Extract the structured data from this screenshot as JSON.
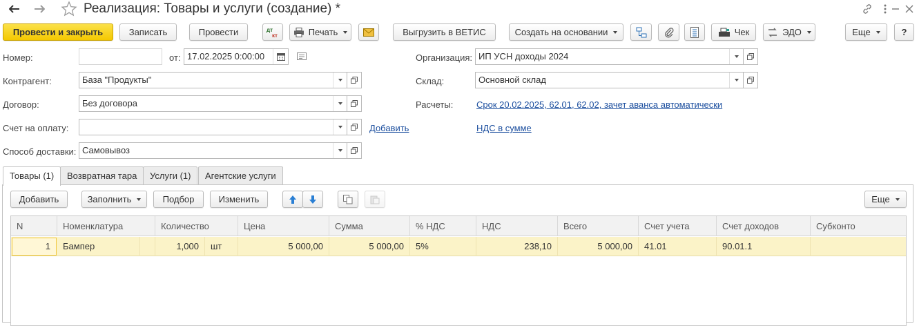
{
  "window": {
    "title": "Реализация: Товары и услуги (создание) *"
  },
  "toolbar": {
    "post_and_close": "Провести и закрыть",
    "save": "Записать",
    "post": "Провести",
    "print": "Печать",
    "export_vetis": "Выгрузить в ВЕТИС",
    "create_based_on": "Создать на основании",
    "receipt": "Чек",
    "edo": "ЭДО",
    "more": "Еще",
    "help": "?"
  },
  "form": {
    "number": {
      "label": "Номер:",
      "value": ""
    },
    "date": {
      "label": "от:",
      "value": "17.02.2025  0:00:00"
    },
    "organization": {
      "label": "Организация:",
      "value": "ИП УСН доходы 2024"
    },
    "counterparty": {
      "label": "Контрагент:",
      "value": "База \"Продукты\""
    },
    "warehouse": {
      "label": "Склад:",
      "value": "Основной склад"
    },
    "contract": {
      "label": "Договор:",
      "value": "Без договора"
    },
    "settlements": {
      "label": "Расчеты:",
      "link": "Срок 20.02.2025, 62.01, 62.02, зачет аванса автоматически"
    },
    "invoice": {
      "label": "Счет на оплату:",
      "value": "",
      "add_link": "Добавить"
    },
    "vat_link": "НДС в сумме",
    "delivery": {
      "label": "Способ доставки:",
      "value": "Самовывоз"
    }
  },
  "tabs": [
    {
      "label": "Товары (1)",
      "active": true
    },
    {
      "label": "Возвратная тара",
      "active": false
    },
    {
      "label": "Услуги (1)",
      "active": false
    },
    {
      "label": "Агентские услуги",
      "active": false
    }
  ],
  "table_toolbar": {
    "add": "Добавить",
    "fill": "Заполнить",
    "selection": "Подбор",
    "change": "Изменить",
    "more": "Еще"
  },
  "table": {
    "columns": [
      "N",
      "Номенклатура",
      "Количество",
      "Цена",
      "Сумма",
      "% НДС",
      "НДС",
      "Всего",
      "Счет учета",
      "Счет доходов",
      "Субконто"
    ],
    "rows": [
      {
        "n": "1",
        "item": "Бампер",
        "qty": "1,000",
        "unit": "шт",
        "price": "5 000,00",
        "sum": "5 000,00",
        "vat_rate": "5%",
        "vat": "238,10",
        "total": "5 000,00",
        "account": "41.01",
        "income_account": "90.01.1",
        "subconto": ""
      }
    ]
  },
  "colors": {
    "primary_button": "#f4c800",
    "selected_row": "#fbf3c8",
    "link": "#1a4d9e"
  }
}
